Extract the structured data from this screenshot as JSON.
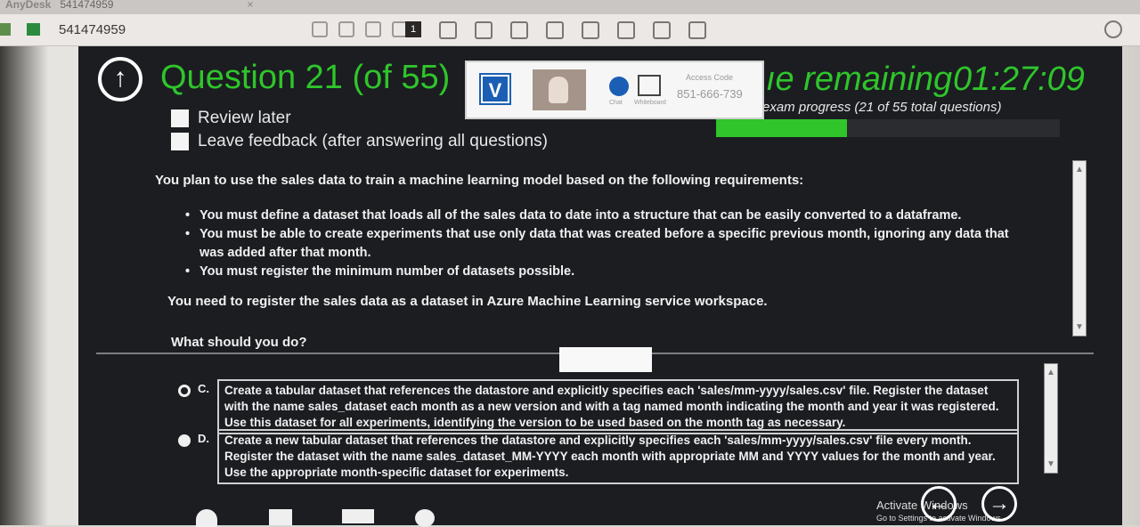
{
  "anydesk": {
    "brand": "AnyDesk",
    "tab_id": "541474959",
    "address_id": "541474959"
  },
  "exam": {
    "question_title": "Question 21 (of 55)",
    "time_remaining_label": "ıe remaining",
    "time_remaining_value": "01:27:09",
    "progress_label": "exam progress (21 of 55 total questions)",
    "progress_fraction": 0.382,
    "review_later": "Review later",
    "leave_feedback": "Leave feedback (after answering all questions)"
  },
  "overlay": {
    "access_code_label": "Access Code",
    "access_code": "851-666-739",
    "chat_label": "Chat",
    "whiteboard_label": "Whiteboard",
    "logo_letter": "V"
  },
  "question": {
    "intro": "You plan to use the sales data to train a machine learning model based on the following requirements:",
    "requirements": [
      "You must define a dataset that loads all of the sales data to date into a structure that can be easily converted to a dataframe.",
      "You must be able to create experiments that use only data that was created before a specific previous month, ignoring any data that was added after that month.",
      "You must register the minimum number of datasets possible."
    ],
    "need": "You need to register the sales data as a dataset in Azure Machine Learning service workspace.",
    "ask": "What should you do?"
  },
  "options": [
    {
      "letter": "C.",
      "text": "Create a tabular dataset that references the datastore and explicitly specifies each 'sales/mm-yyyy/sales.csv' file. Register the dataset with the name sales_dataset each month as a new version and with a tag named month indicating the month and year it was registered. Use this dataset for all experiments, identifying the version to be used based on the month tag as necessary.",
      "selected": true
    },
    {
      "letter": "D.",
      "text": "Create a new tabular dataset that references the datastore and explicitly specifies each 'sales/mm-yyyy/sales.csv' file every month. Register the dataset with the name sales_dataset_MM-YYYY each month with appropriate MM and YYYY values for the month and year. Use the appropriate month-specific dataset for experiments.",
      "selected": false
    }
  ],
  "watermark": {
    "line1": "Activate Windows",
    "line2": "Go to Settings to activate Windows."
  },
  "nav": {
    "back_symbol": "←",
    "next_symbol": "→",
    "question_back_symbol": "↑"
  }
}
